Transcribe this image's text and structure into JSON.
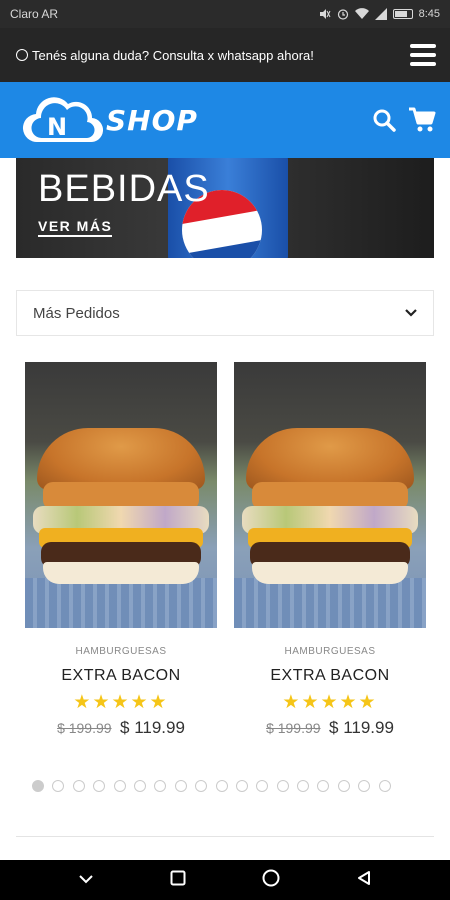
{
  "status_bar": {
    "carrier": "Claro AR",
    "time": "8:45",
    "icons": [
      "mute-icon",
      "alarm-icon",
      "wifi-icon",
      "signal-icon",
      "battery-icon"
    ]
  },
  "top_bar": {
    "message": "Tenés alguna duda? Consulta x whatsapp ahora!",
    "icon": "whatsapp-icon",
    "menu_icon": "hamburger-menu-icon"
  },
  "header": {
    "logo_letter": "N",
    "logo_text": "SHOP",
    "brand_color": "#1e88e5",
    "icons": [
      "search-icon",
      "cart-icon"
    ]
  },
  "banner": {
    "title": "BEBIDAS",
    "link": "VER MÁS"
  },
  "sort": {
    "selected": "Más Pedidos",
    "icon": "chevron-down-icon"
  },
  "products": [
    {
      "category": "HAMBURGUESAS",
      "name": "EXTRA BACON",
      "rating": "★★★★★",
      "old_price": "$ 199.99",
      "price": "$ 119.99"
    },
    {
      "category": "HAMBURGUESAS",
      "name": "EXTRA BACON",
      "rating": "★★★★★",
      "old_price": "$ 199.99",
      "price": "$ 119.99"
    }
  ],
  "carousel": {
    "total_dots": 18,
    "active_index": 0
  },
  "nav_bar": {
    "icons": [
      "back-chevron-icon",
      "recents-square-icon",
      "home-circle-icon",
      "back-triangle-icon"
    ]
  }
}
